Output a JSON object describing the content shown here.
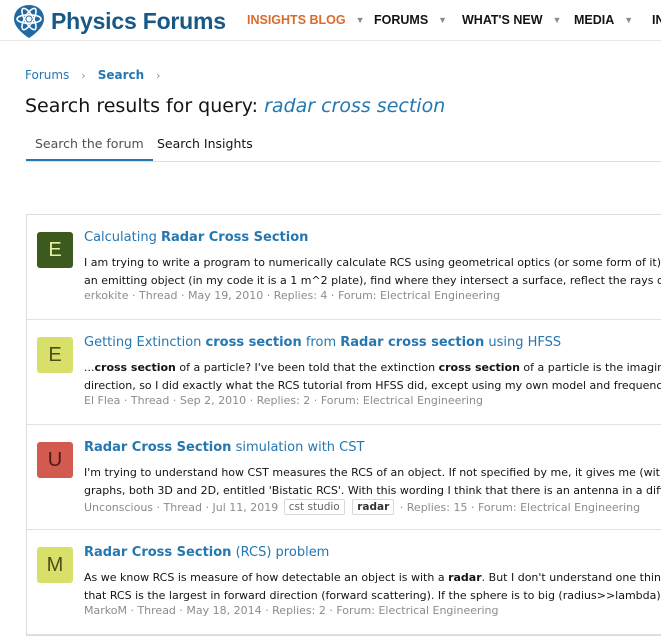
{
  "header": {
    "logo_text": "Physics Forums",
    "nav": [
      {
        "label": "INSIGHTS BLOG",
        "active": true
      },
      {
        "label": "FORUMS"
      },
      {
        "label": "WHAT'S NEW"
      },
      {
        "label": "MEDIA"
      },
      {
        "label": "IN"
      }
    ]
  },
  "breadcrumb": {
    "items": [
      "Forums",
      "Search"
    ]
  },
  "page": {
    "title_prefix": "Search results for query: ",
    "query": "radar cross section"
  },
  "tabs": [
    "Search the forum",
    "Search Insights"
  ],
  "results": [
    {
      "avatar_letter": "E",
      "avatar_bg": "#3c5a1e",
      "avatar_fg": "#e6f0a0",
      "title": [
        {
          "t": "Calculating "
        },
        {
          "t": "Radar Cross Section",
          "b": true
        }
      ],
      "lines": [
        [
          {
            "t": "I am trying to write a program to numerically calculate RCS using geometrical optics (or some form of it). Basically"
          }
        ],
        [
          {
            "t": "an emitting object (in my code it is a 1 m^2 plate), find where they intersect a surface, reflect the rays off of this sur"
          }
        ]
      ],
      "meta": [
        {
          "t": "erkokite"
        },
        {
          "t": "Thread"
        },
        {
          "t": "May 19, 2010"
        },
        {
          "t": "Replies: 4"
        },
        {
          "t": "Forum: Electrical Engineering"
        }
      ]
    },
    {
      "avatar_letter": "E",
      "avatar_bg": "#d9e069",
      "avatar_fg": "#4a4f17",
      "title": [
        {
          "t": "Getting Extinction "
        },
        {
          "t": "cross section",
          "b": true
        },
        {
          "t": " from "
        },
        {
          "t": "Radar cross section",
          "b": true
        },
        {
          "t": " using HFSS"
        }
      ],
      "lines": [
        [
          {
            "t": "..."
          },
          {
            "t": "cross section",
            "b": true
          },
          {
            "t": " of a particle? I've been told that the extinction "
          },
          {
            "t": "cross section",
            "b": true
          },
          {
            "t": " of a particle is the imaginary part of t"
          }
        ],
        [
          {
            "t": "direction, so I did exactly what the RCS tutorial from HFSS did, except using my own model and frequencies, and g"
          }
        ]
      ],
      "meta": [
        {
          "t": "El Flea"
        },
        {
          "t": "Thread"
        },
        {
          "t": "Sep 2, 2010"
        },
        {
          "t": "Replies: 2"
        },
        {
          "t": "Forum: Electrical Engineering"
        }
      ]
    },
    {
      "avatar_letter": "U",
      "avatar_bg": "#d25a4f",
      "avatar_fg": "#4d1a15",
      "title": [
        {
          "t": "Radar Cross Section",
          "b": true
        },
        {
          "t": " simulation with CST"
        }
      ],
      "lines": [
        [
          {
            "t": "I'm trying to understand how CST measures the RCS of an object. If not specified by me, it gives me (with a very br"
          }
        ],
        [
          {
            "t": "graphs, both 3D and 2D, entitled 'Bistatic RCS'. With this wording I think that there is an antenna in a different dire"
          }
        ]
      ],
      "meta": [
        {
          "t": "Unconscious"
        },
        {
          "t": "Thread"
        },
        {
          "t": "Jul 11, 2019"
        },
        {
          "t": "cst studio",
          "tag": true
        },
        {
          "t": "radar",
          "tag": true,
          "b": true
        },
        {
          "t": "Replies: 15"
        },
        {
          "t": "Forum: Electrical Engineering"
        }
      ]
    },
    {
      "avatar_letter": "M",
      "avatar_bg": "#d9e069",
      "avatar_fg": "#4a4f17",
      "title": [
        {
          "t": "Radar Cross Section",
          "b": true
        },
        {
          "t": " (RCS) problem"
        }
      ],
      "lines": [
        [
          {
            "t": "As we know RCS is measure of how detectable an object is with a "
          },
          {
            "t": "radar",
            "b": true
          },
          {
            "t": ". But I don't understand one thing. If we tal"
          }
        ],
        [
          {
            "t": "that RCS is the largest in forward direction (forward scattering). If the sphere is to big (radius>>lambda), still this fo"
          }
        ]
      ],
      "meta": [
        {
          "t": "MarkoM"
        },
        {
          "t": "Thread"
        },
        {
          "t": "May 18, 2014"
        },
        {
          "t": "Replies: 2"
        },
        {
          "t": "Forum: Electrical Engineering"
        }
      ]
    }
  ]
}
